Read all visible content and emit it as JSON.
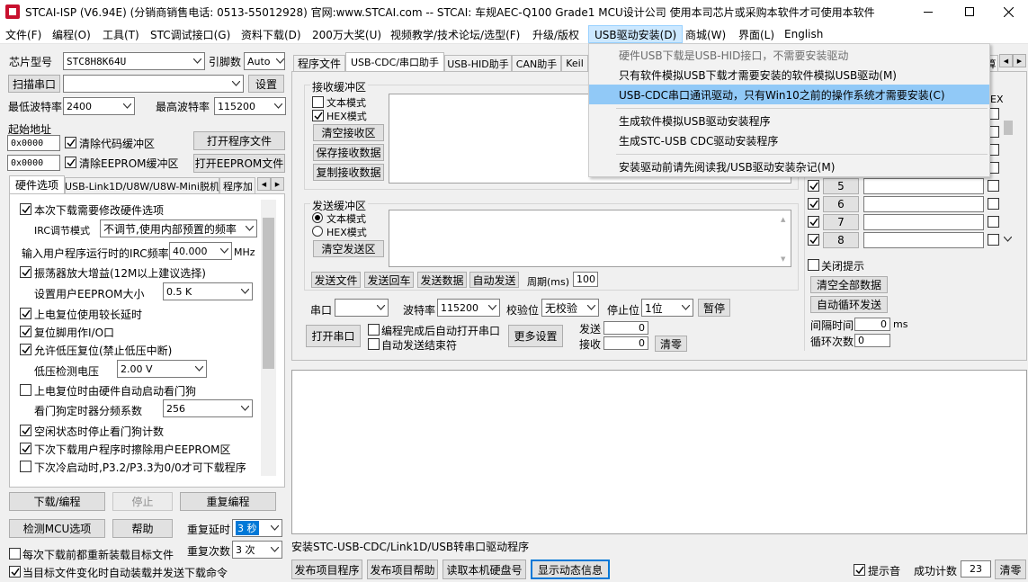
{
  "window": {
    "title": "STCAI-ISP (V6.94E) (分销商销售电话: 0513-55012928) 官网:www.STCAI.com  -- STCAI: 车规AEC-Q100 Grade1 MCU设计公司 使用本司芯片或采购本软件才可使用本软件",
    "controls": [
      "minimize",
      "maximize",
      "close"
    ]
  },
  "menubar": [
    "文件(F)",
    "编程(O)",
    "工具(T)",
    "STC调试接口(G)",
    "资料下载(D)",
    "200万大奖(U)",
    "视频教学/技术论坛/选型(F)",
    "升级/版权",
    "USB驱动安装(D)",
    "商城(W)",
    "界面(L)",
    "English"
  ],
  "usb_menu": {
    "items": [
      {
        "label": "硬件USB下载是USB-HID接口，不需要安装驱动",
        "disabled": true
      },
      {
        "label": "只有软件模拟USB下载才需要安装的软件模拟USB驱动(M)"
      },
      {
        "label": "USB-CDC串口通讯驱动，只有Win10之前的操作系统才需要安装(C)",
        "highlighted": true
      },
      {
        "label": "生成软件模拟USB驱动安装程序"
      },
      {
        "label": "生成STC-USB CDC驱动安装程序"
      },
      {
        "label": "安装驱动前请先阅读我/USB驱动安装杂记(M)"
      }
    ]
  },
  "left": {
    "chip_type_label": "芯片型号",
    "chip_type_value": "STC8H8K64U",
    "pins_label": "引脚数",
    "pins_value": "Auto",
    "scan_port_button": "扫描串口",
    "port_value": "",
    "settings_button": "设置",
    "min_baud_label": "最低波特率",
    "min_baud_value": "2400",
    "max_baud_label": "最高波特率",
    "max_baud_value": "115200",
    "start_addr_label": "起始地址",
    "addr1": "0x0000",
    "addr2": "0x0000",
    "clear_code_label": "清除代码缓冲区",
    "clear_eeprom_label": "清除EEPROM缓冲区",
    "open_program_button": "打开程序文件",
    "open_eeprom_button": "打开EEPROM文件",
    "tabs": [
      "硬件选项",
      "USB-Link1D/U8W/U8W-Mini脱机",
      "程序加"
    ],
    "hw_options": {
      "modify_hw": "本次下载需要修改硬件选项",
      "irc_mode_label": "IRC调节模式",
      "irc_mode_value": "不调节,使用内部预置的频率",
      "irc_freq_label": "输入用户程序运行时的IRC频率",
      "irc_freq_value": "40.000",
      "irc_freq_unit": "MHz",
      "osc_gain": "振荡器放大增益(12M以上建议选择)",
      "eeprom_size_label": "设置用户EEPROM大小",
      "eeprom_size_value": "0.5 K",
      "por_delay": "上电复位使用较长延时",
      "reset_pin_io": "复位脚用作I/O口",
      "lvd_reset": "允许低压复位(禁止低压中断)",
      "lvd_voltage_label": "低压检测电压",
      "lvd_voltage_value": "2.00 V",
      "wdt_on_por": "上电复位时由硬件自动启动看门狗",
      "wdt_prescaler_label": "看门狗定时器分频系数",
      "wdt_prescaler_value": "256",
      "wdt_idle_stop": "空闲状态时停止看门狗计数",
      "erase_eeprom_next": "下次下载用户程序时擦除用户EEPROM区",
      "p32_p33_cold": "下次冷启动时,P3.2/P3.3为0/0才可下载程序"
    },
    "download_button": "下载/编程",
    "stop_button": "停止",
    "reprogram_button": "重复编程",
    "detect_mcu_button": "检测MCU选项",
    "help_button": "帮助",
    "repeat_delay_label": "重复延时",
    "repeat_delay_value": "3 秒",
    "repeat_count_label": "重复次数",
    "repeat_count_value": "3 次",
    "reload_each_time": "每次下载前都重新装载目标文件",
    "auto_download_on_change": "当目标文件变化时自动装载并发送下载命令"
  },
  "right": {
    "tabs": [
      "程序文件",
      "USB-CDC/串口助手",
      "USB-HID助手",
      "CAN助手",
      "Keil"
    ],
    "tab_tail": "算",
    "recv": {
      "title": "接收缓冲区",
      "text_mode": "文本模式",
      "hex_mode": "HEX模式",
      "clear_button": "清空接收区",
      "save_button": "保存接收数据",
      "copy_button": "复制接收数据"
    },
    "send": {
      "title": "发送缓冲区",
      "text_mode": "文本模式",
      "hex_mode": "HEX模式",
      "clear_button": "清空发送区",
      "send_file_button": "发送文件",
      "send_enter_button": "发送回车",
      "send_data_button": "发送数据",
      "auto_send_button": "自动发送",
      "period_label": "周期(ms)",
      "period_value": "100"
    },
    "port_label": "串口",
    "port_value": "",
    "baud_label": "波特率",
    "baud_value": "115200",
    "parity_label": "校验位",
    "parity_value": "无校验",
    "stopbit_label": "停止位",
    "stopbit_value": "1位",
    "pause_button": "暂停",
    "open_port_button": "打开串口",
    "auto_open_after_prog": "编程完成后自动打开串口",
    "auto_send_end": "自动发送结束符",
    "more_settings_button": "更多设置",
    "send_count_label": "发送",
    "send_count_value": "0",
    "recv_count_label": "接收",
    "recv_count_value": "0",
    "clear_count_button": "清零",
    "multi": {
      "hex_header": "EX",
      "rows": [
        "5",
        "6",
        "7",
        "8"
      ],
      "close_tip": "关闭提示",
      "clear_all_button": "清空全部数据",
      "auto_loop_button": "自动循环发送",
      "interval_label": "间隔时间",
      "interval_value": "0",
      "interval_unit": "ms",
      "loop_count_label": "循环次数",
      "loop_count_value": "0"
    }
  },
  "status_text": "安装STC-USB-CDC/Link1D/USB转串口驱动程序",
  "bottom": {
    "publish_program": "发布项目程序",
    "publish_help": "发布项目帮助",
    "read_disk_serial": "读取本机硬盘号",
    "show_dynamic_info": "显示动态信息",
    "prompt_sound": "提示音",
    "success_count_label": "成功计数",
    "success_count_value": "23",
    "clear_button": "清零"
  },
  "colors": {
    "menu_highlight": "#91c9f7",
    "menubar_active": "#cce8ff",
    "focus_border": "#0078d7"
  }
}
